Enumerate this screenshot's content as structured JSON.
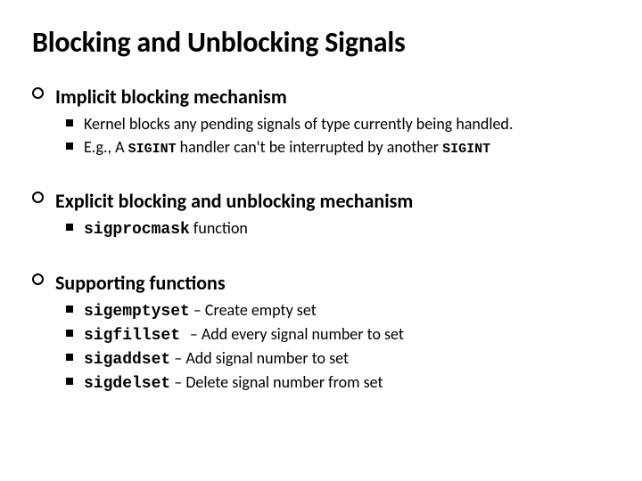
{
  "title": "Blocking and Unblocking Signals",
  "sections": [
    {
      "heading": "Implicit blocking mechanism",
      "items": [
        {
          "plain": "Kernel blocks any pending signals of type currently being handled."
        },
        {
          "pre": "E.g., A ",
          "code1": "SIGINT",
          "mid": " handler can't be interrupted by another ",
          "code2": "SIGINT"
        }
      ]
    },
    {
      "heading": "Explicit blocking and unblocking mechanism",
      "items": [
        {
          "code": "sigprocmask",
          "post": " function"
        }
      ]
    },
    {
      "heading": "Supporting functions",
      "items": [
        {
          "code": "sigemptyset",
          "post": " – Create empty set"
        },
        {
          "code": "sigfillset ",
          "post": " – Add every signal number to set"
        },
        {
          "code": "sigaddset",
          "post": " – Add signal number to set"
        },
        {
          "code": "sigdelset",
          "post": " – Delete signal number from set"
        }
      ]
    }
  ]
}
